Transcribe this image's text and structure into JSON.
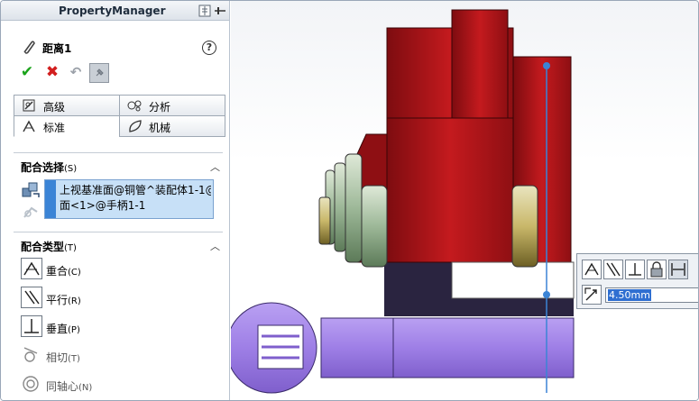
{
  "header": {
    "title": "PropertyManager"
  },
  "feature": {
    "name": "距离1"
  },
  "help": {
    "label": "?"
  },
  "actions": {
    "ok": "✔",
    "cancel": "✖",
    "undo": "↶"
  },
  "tabs": [
    {
      "label": "高级"
    },
    {
      "label": "分析"
    },
    {
      "label": "标准"
    },
    {
      "label": "机械"
    }
  ],
  "mate_selection": {
    "title": "配合选择",
    "suffix": "(S)",
    "items": [
      "上视基准面@铜管^装配体1-1@",
      "面<1>@手柄1-1"
    ]
  },
  "mate_types": {
    "title": "配合类型",
    "suffix": "(T)",
    "items": [
      {
        "label": "重合",
        "key": "(C)"
      },
      {
        "label": "平行",
        "key": "(R)"
      },
      {
        "label": "垂直",
        "key": "(P)"
      },
      {
        "label": "相切",
        "key": "(T)"
      },
      {
        "label": "同轴心",
        "key": "(N)"
      }
    ]
  },
  "popup": {
    "distance": "4.50mm"
  },
  "colors": {
    "red_part": "#b5161a",
    "purple_part": "#9e7fe6",
    "green_part": "#8fb08a",
    "dark_part": "#2a2440",
    "accent_blue": "#3b84d6",
    "selection_bg": "#c7e0f7"
  }
}
